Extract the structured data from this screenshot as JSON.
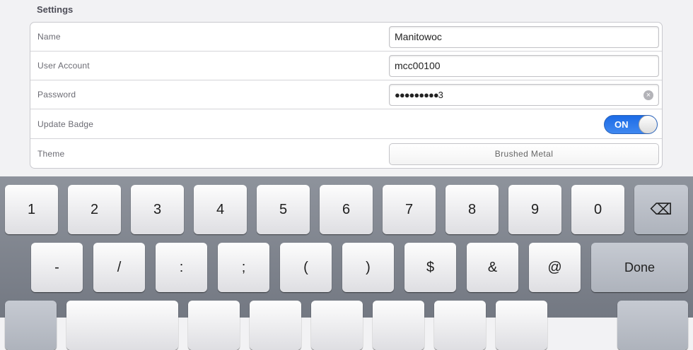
{
  "settings": {
    "section_title": "Settings",
    "rows": [
      {
        "label": "Name",
        "value": "Manitowoc"
      },
      {
        "label": "User Account",
        "value": "mcc00100"
      },
      {
        "label": "Password",
        "value": "●●●●●●●●●3"
      },
      {
        "label": "Update Badge",
        "toggle_state": "ON"
      },
      {
        "label": "Theme",
        "value": "Brushed Metal"
      }
    ]
  },
  "keyboard": {
    "row1": [
      "1",
      "2",
      "3",
      "4",
      "5",
      "6",
      "7",
      "8",
      "9",
      "0"
    ],
    "backspace_symbol": "⌫",
    "row2": [
      "-",
      "/",
      ":",
      ";",
      "(",
      ")",
      "$",
      "&",
      "@"
    ],
    "done_label": "Done",
    "row3": [
      "",
      "",
      "",
      "",
      "",
      "",
      "",
      "",
      "",
      "",
      ""
    ]
  },
  "colors": {
    "toggle_on": "#1c6be6",
    "keyboard_bg": "#8e939c"
  }
}
